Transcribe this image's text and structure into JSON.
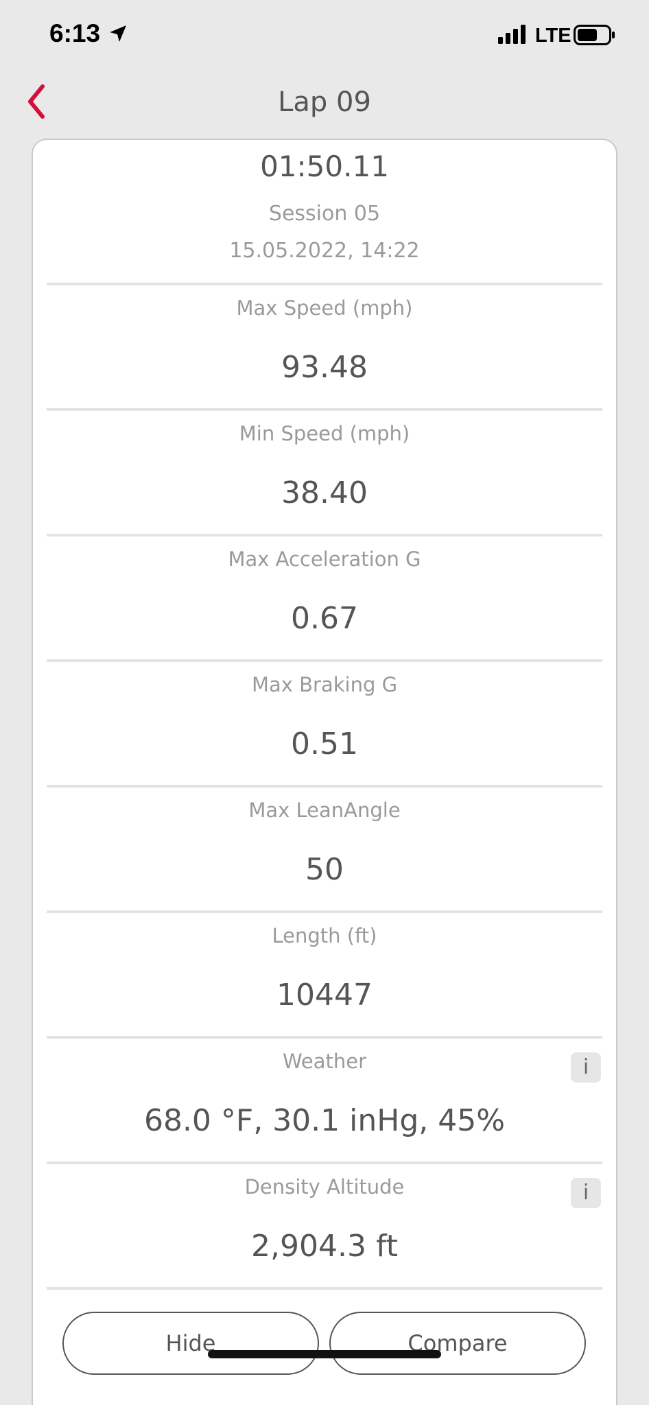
{
  "status_bar": {
    "time": "6:13",
    "network": "LTE",
    "icons": [
      "location-arrow-icon",
      "signal-icon",
      "battery-icon"
    ]
  },
  "nav": {
    "title": "Lap 09",
    "back_icon": "chevron-left-icon",
    "accent_color": "#d0103a"
  },
  "lap": {
    "time": "01:50.11",
    "session": "Session 05",
    "date": "15.05.2022, 14:22"
  },
  "stats": [
    {
      "label": "Max Speed (mph)",
      "value": "93.48"
    },
    {
      "label": "Min Speed (mph)",
      "value": "38.40"
    },
    {
      "label": "Max Acceleration G",
      "value": "0.67"
    },
    {
      "label": "Max Braking G",
      "value": "0.51"
    },
    {
      "label": "Max LeanAngle",
      "value": "50"
    },
    {
      "label": "Length (ft)",
      "value": "10447"
    },
    {
      "label": "Weather",
      "value": "68.0 °F, 30.1 inHg, 45%",
      "info": "i"
    },
    {
      "label": "Density Altitude",
      "value": "2,904.3 ft",
      "info": "i"
    }
  ],
  "buttons": {
    "hide": "Hide",
    "compare": "Compare"
  }
}
